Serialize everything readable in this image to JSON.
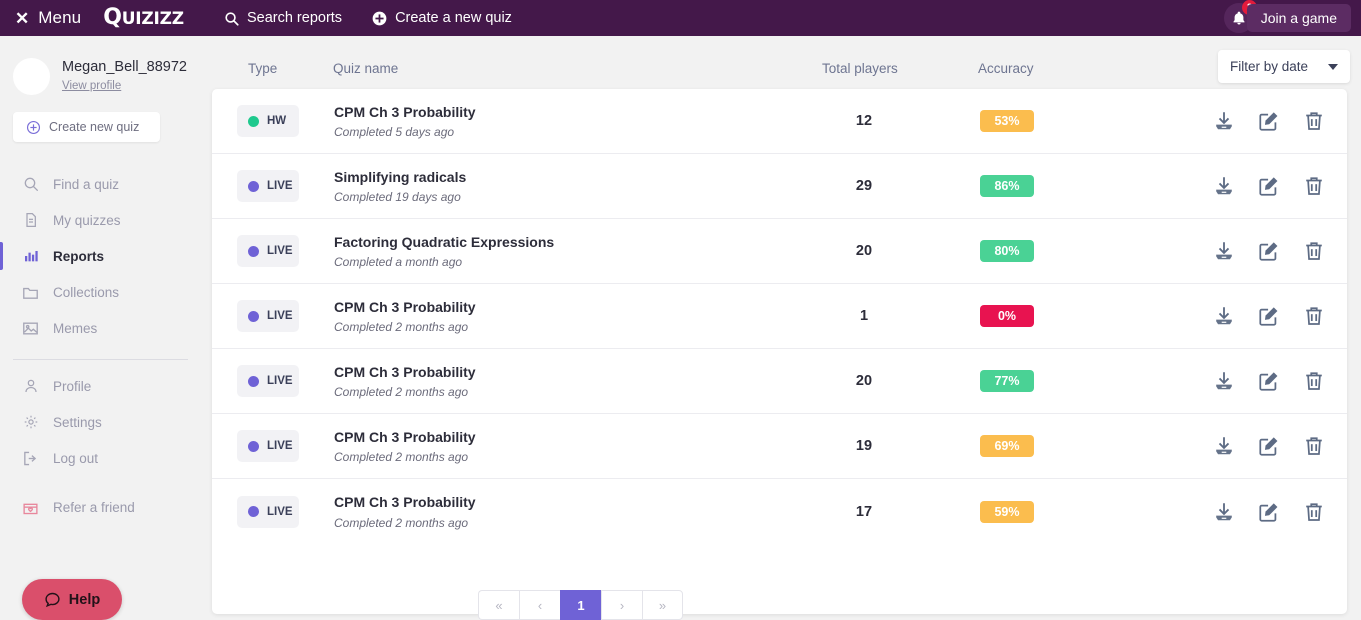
{
  "topbar": {
    "menu_label": "Menu",
    "close_icon": "close-icon",
    "logo_text": "Quizizz",
    "search_label": "Search reports",
    "create_label": "Create a new quiz",
    "notification_count": "2",
    "join_label": "Join a game",
    "background_color": "#44184a"
  },
  "sidebar": {
    "username": "Megan_Bell_88972",
    "view_profile": "View profile",
    "create_quiz_label": "Create new quiz",
    "items": [
      {
        "label": "Find a quiz",
        "icon": "search-icon",
        "active": false
      },
      {
        "label": "My quizzes",
        "icon": "document-icon",
        "active": false
      },
      {
        "label": "Reports",
        "icon": "bar-chart-icon",
        "active": true
      },
      {
        "label": "Collections",
        "icon": "folder-icon",
        "active": false
      },
      {
        "label": "Memes",
        "icon": "image-icon",
        "active": false
      },
      {
        "label": "Profile",
        "icon": "user-icon",
        "active": false
      },
      {
        "label": "Settings",
        "icon": "gear-icon",
        "active": false
      },
      {
        "label": "Log out",
        "icon": "logout-icon",
        "active": false
      },
      {
        "label": "Refer a friend",
        "icon": "gift-icon",
        "active": false
      }
    ],
    "help_label": "Help",
    "help_color": "#da4f6b",
    "active_accent": "#6f62d6"
  },
  "table": {
    "headers": {
      "type": "Type",
      "quiz_name": "Quiz name",
      "total_players": "Total players",
      "accuracy": "Accuracy"
    },
    "filter_label": "Filter by date",
    "rows": [
      {
        "type": "HW",
        "type_color": "#1fc98e",
        "name": "CPM Ch 3 Probability",
        "completed": "Completed 5 days ago",
        "players": "12",
        "accuracy": "53%",
        "accuracy_color": "#fbbd4e"
      },
      {
        "type": "LIVE",
        "type_color": "#6f62d6",
        "name": "Simplifying radicals",
        "completed": "Completed 19 days ago",
        "players": "29",
        "accuracy": "86%",
        "accuracy_color": "#4ad295"
      },
      {
        "type": "LIVE",
        "type_color": "#6f62d6",
        "name": "Factoring Quadratic Expressions",
        "completed": "Completed a month ago",
        "players": "20",
        "accuracy": "80%",
        "accuracy_color": "#4ad295"
      },
      {
        "type": "LIVE",
        "type_color": "#6f62d6",
        "name": "CPM Ch 3 Probability",
        "completed": "Completed 2 months ago",
        "players": "1",
        "accuracy": "0%",
        "accuracy_color": "#e81350"
      },
      {
        "type": "LIVE",
        "type_color": "#6f62d6",
        "name": "CPM Ch 3 Probability",
        "completed": "Completed 2 months ago",
        "players": "20",
        "accuracy": "77%",
        "accuracy_color": "#4ad295"
      },
      {
        "type": "LIVE",
        "type_color": "#6f62d6",
        "name": "CPM Ch 3 Probability",
        "completed": "Completed 2 months ago",
        "players": "19",
        "accuracy": "69%",
        "accuracy_color": "#fbbd4e"
      },
      {
        "type": "LIVE",
        "type_color": "#6f62d6",
        "name": "CPM Ch 3 Probability",
        "completed": "Completed 2 months ago",
        "players": "17",
        "accuracy": "59%",
        "accuracy_color": "#fbbd4e"
      }
    ],
    "row_actions": [
      "download-icon",
      "edit-icon",
      "delete-icon"
    ]
  },
  "pagination": {
    "first_label": "«",
    "prev_label": "‹",
    "current_page": "1",
    "next_label": "›",
    "last_label": "»"
  }
}
